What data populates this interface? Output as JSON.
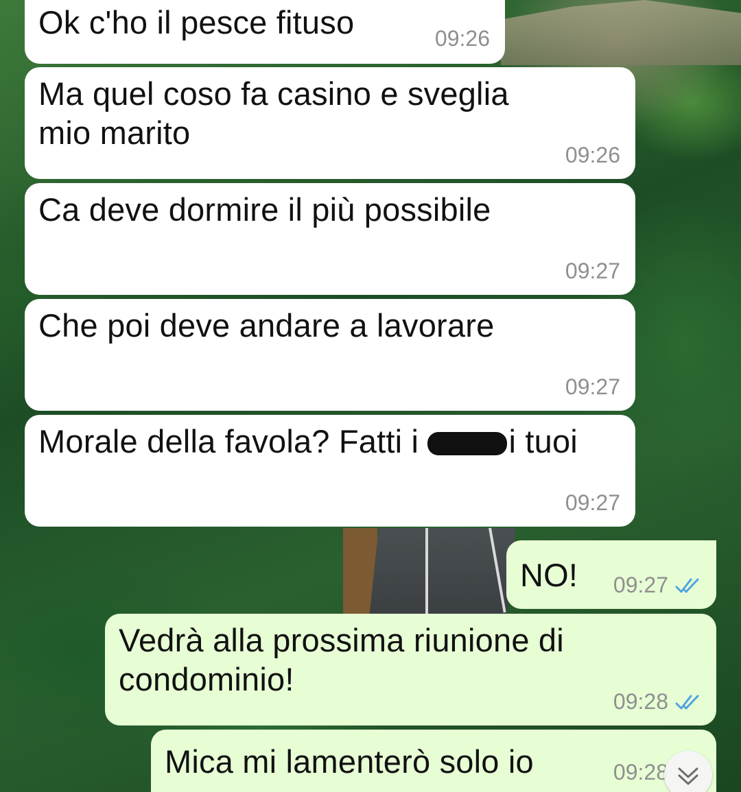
{
  "messages": [
    {
      "direction": "incoming",
      "text": "Ok c'ho il pesce fituso",
      "time": "09:26"
    },
    {
      "direction": "incoming",
      "text": "Ma quel coso fa casino e sveglia\nmio marito",
      "time": "09:26"
    },
    {
      "direction": "incoming",
      "text": "Ca deve dormire il più possibile",
      "time": "09:27"
    },
    {
      "direction": "incoming",
      "text": "Che poi deve andare a lavorare",
      "time": "09:27"
    },
    {
      "direction": "incoming",
      "text_before": "Morale della favola? Fatti i ",
      "text_after": "i tuoi",
      "time": "09:27"
    },
    {
      "direction": "outgoing",
      "text": "NO!",
      "time": "09:27",
      "status": "read"
    },
    {
      "direction": "outgoing",
      "text": "Vedrà alla prossima riunione di\ncondominio!",
      "time": "09:28",
      "status": "read"
    },
    {
      "direction": "outgoing",
      "text": "Mica mi lamenterò solo io",
      "time": "09:28",
      "status": "read"
    }
  ],
  "icons": {
    "read_receipt": "double-check-icon",
    "scroll_down": "chevron-down-double-icon"
  },
  "colors": {
    "incoming_bubble": "#ffffff",
    "outgoing_bubble": "#e7fed5",
    "read_tick": "#4fa3e0",
    "timestamp": "#8f8f8f"
  }
}
